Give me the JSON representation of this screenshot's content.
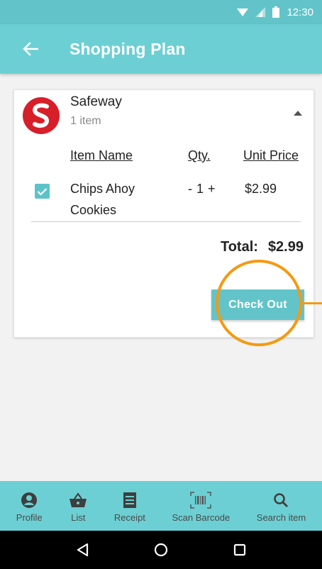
{
  "status_bar": {
    "time": "12:30"
  },
  "header": {
    "title": "Shopping Plan"
  },
  "store": {
    "name": "Safeway",
    "item_count": "1 item",
    "brand_color": "#d71f2a"
  },
  "table": {
    "headers": [
      "Item Name",
      "Qty.",
      "Unit Price"
    ],
    "rows": [
      {
        "checked": true,
        "name": "Chips Ahoy Cookies",
        "qty_minus": "-",
        "qty": "1",
        "qty_plus": "+",
        "unit_price": "$2.99"
      }
    ]
  },
  "total": {
    "label": "Total:",
    "value": "$2.99"
  },
  "checkout": {
    "label": "Check Out"
  },
  "bottom_nav": {
    "items": [
      {
        "label": "Profile",
        "icon": "profile-icon"
      },
      {
        "label": "List",
        "icon": "basket-icon"
      },
      {
        "label": "Receipt",
        "icon": "receipt-icon"
      },
      {
        "label": "Scan Barcode",
        "icon": "barcode-icon"
      },
      {
        "label": "Search item",
        "icon": "search-icon"
      }
    ]
  },
  "colors": {
    "accent": "#6ccfd3",
    "button": "#62c4c9",
    "highlight": "#f39a14"
  }
}
